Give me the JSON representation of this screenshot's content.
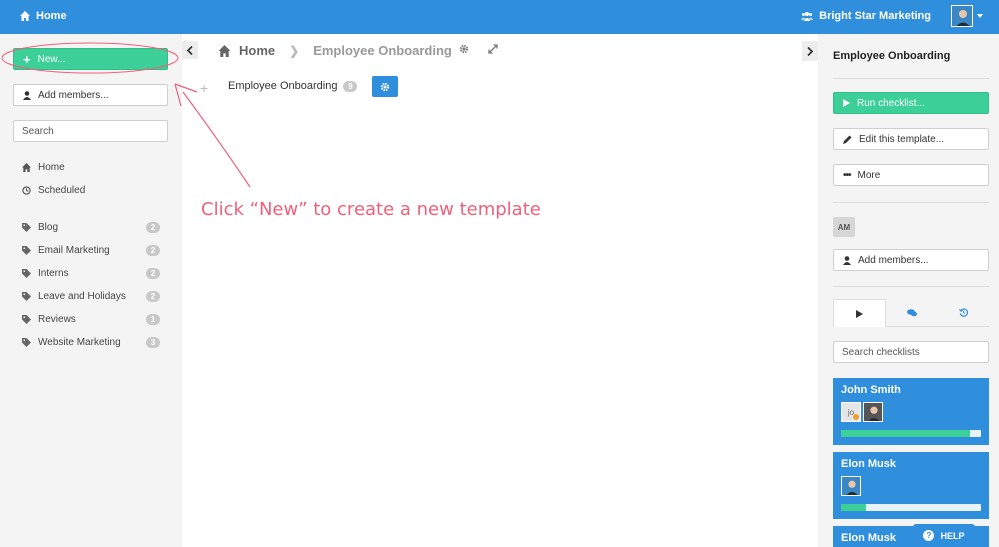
{
  "topbar": {
    "home_label": "Home",
    "org_label": "Bright Star Marketing"
  },
  "sidebar": {
    "new_label": "New...",
    "add_members_label": "Add members...",
    "search_placeholder": "Search",
    "nav": [
      {
        "label": "Home",
        "icon": "home-icon"
      },
      {
        "label": "Scheduled",
        "icon": "clock-icon"
      }
    ],
    "tags": [
      {
        "label": "Blog",
        "count": "2"
      },
      {
        "label": "Email Marketing",
        "count": "2"
      },
      {
        "label": "Interns",
        "count": "2"
      },
      {
        "label": "Leave and Holidays",
        "count": "2"
      },
      {
        "label": "Reviews",
        "count": "1"
      },
      {
        "label": "Website Marketing",
        "count": "3"
      }
    ]
  },
  "main": {
    "breadcrumb": {
      "home": "Home",
      "current": "Employee Onboarding"
    },
    "template_title": "Employee Onboarding",
    "template_count": "9",
    "annotation": "Click “New” to create a new template"
  },
  "right": {
    "title": "Employee Onboarding",
    "run_label": "Run checklist...",
    "edit_label": "Edit this template...",
    "more_label": "More",
    "member_initials": "AM",
    "add_members_label": "Add members...",
    "search_placeholder": "Search checklists",
    "checklists": [
      {
        "name": "John Smith",
        "initials": "jo",
        "progress": 0.92
      },
      {
        "name": "Elon Musk",
        "progress": 0.18
      },
      {
        "name": "Elon Musk"
      }
    ]
  },
  "help_label": "HELP",
  "colors": {
    "primary": "#2f8fdd",
    "green": "#3ccf97",
    "annotation": "#f0607a"
  }
}
